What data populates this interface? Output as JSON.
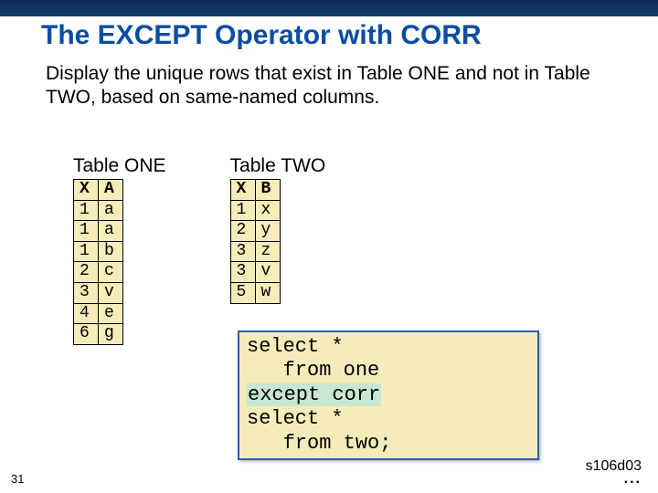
{
  "title": "The EXCEPT Operator with CORR",
  "description": "Display the unique rows that exist in Table ONE and not in Table TWO, based on same-named columns.",
  "table_one": {
    "title": "Table ONE",
    "headers": [
      "X",
      "A"
    ],
    "rows": [
      [
        "1",
        "a"
      ],
      [
        "1",
        "a"
      ],
      [
        "1",
        "b"
      ],
      [
        "2",
        "c"
      ],
      [
        "3",
        "v"
      ],
      [
        "4",
        "e"
      ],
      [
        "6",
        "g"
      ]
    ]
  },
  "table_two": {
    "title": "Table TWO",
    "headers": [
      "X",
      "B"
    ],
    "rows": [
      [
        "1",
        "x"
      ],
      [
        "2",
        "y"
      ],
      [
        "3",
        "z"
      ],
      [
        "3",
        "v"
      ],
      [
        "5",
        "w"
      ]
    ]
  },
  "code": {
    "line1": "select *",
    "line2": "   from one",
    "line3_hl": "except corr",
    "line4": "select *",
    "line5": "   from two;"
  },
  "slide_number": "31",
  "footer_code": "s106d03",
  "footer_dots": "..."
}
